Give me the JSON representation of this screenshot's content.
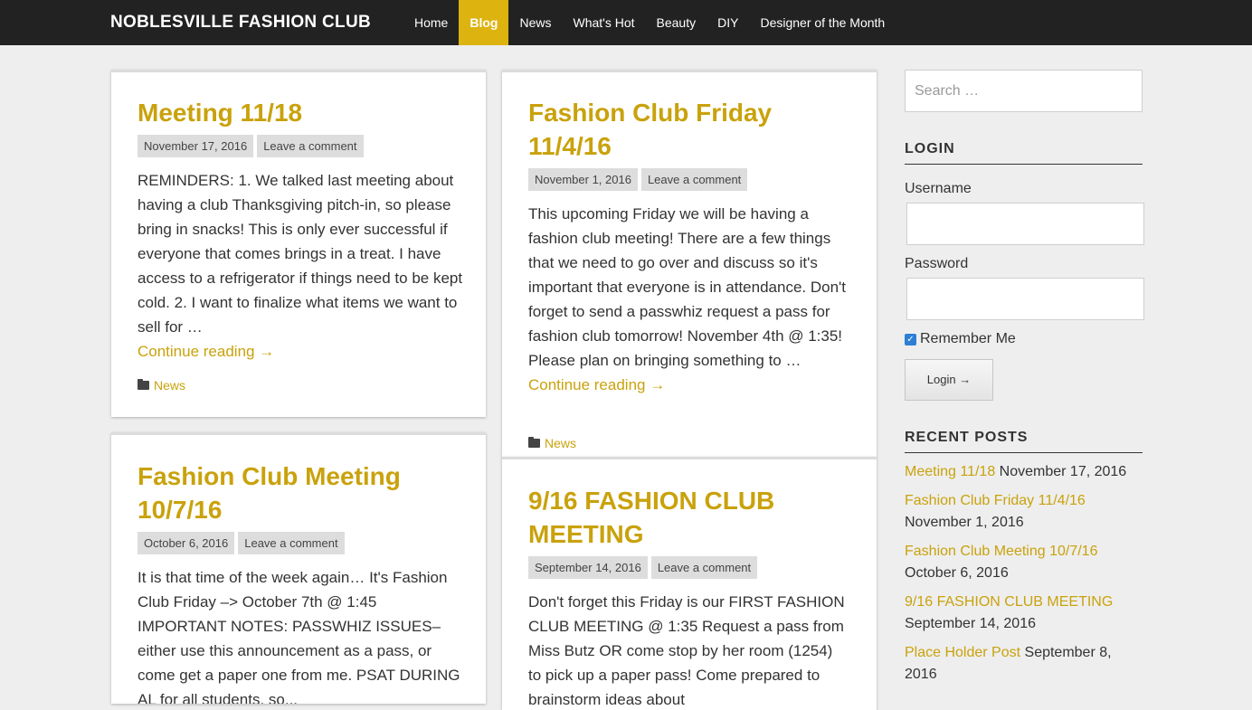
{
  "site": {
    "title": "NOBLESVILLE FASHION CLUB"
  },
  "nav": {
    "items": [
      "Home",
      "Blog",
      "News",
      "What's Hot",
      "Beauty",
      "DIY",
      "Designer of the Month"
    ],
    "active": "Blog"
  },
  "colors": {
    "accent": "#ddb30f",
    "link": "#c9a20c",
    "topbar": "#222222"
  },
  "posts": [
    {
      "title": "Meeting 11/18",
      "date": "November 17, 2016",
      "comment": "Leave a comment",
      "excerpt": "REMINDERS: 1. We talked last meeting about having a club Thanksgiving pitch-in, so please bring in snacks! This is only ever successful if everyone that comes brings in a treat. I have access to a refrigerator if things need to be kept cold. 2. I want to finalize what items we want to sell for …",
      "more": "Continue reading →",
      "category": "News"
    },
    {
      "title": "Fashion Club Friday 11/4/16",
      "date": "November 1, 2016",
      "comment": "Leave a comment",
      "excerpt": "This upcoming Friday we will be having a fashion club meeting! There are a few things that we need to go over and discuss so it's important that everyone is in attendance. Don't forget to send a passwhiz request a pass for fashion club tomorrow! November 4th @ 1:35! Please plan on bringing something to …",
      "more": "Continue reading →",
      "category": "News"
    },
    {
      "title": "Fashion Club Meeting 10/7/16",
      "date": "October 6, 2016",
      "comment": "Leave a comment",
      "excerpt": "It is that time of the week again… It's Fashion Club Friday –> October 7th @ 1:45 IMPORTANT NOTES: PASSWHIZ ISSUES– either use this announcement as a pass, or come get a paper one from me. PSAT DURING AL for all students, so..."
    },
    {
      "title": "9/16 FASHION CLUB MEETING",
      "date": "September 14, 2016",
      "comment": "Leave a comment",
      "excerpt": "Don't forget this Friday is our FIRST FASHION CLUB MEETING @ 1:35 Request a pass from Miss Butz OR come stop by her room (1254) to pick up a paper pass! Come prepared to brainstorm ideas about"
    }
  ],
  "sidebar": {
    "search_placeholder": "Search …",
    "login_title": "LOGIN",
    "username_label": "Username",
    "password_label": "Password",
    "remember_label": "Remember Me",
    "login_button": "Login →",
    "recent_title": "RECENT POSTS",
    "recent": [
      {
        "title": "Meeting 11/18",
        "date": "November 17, 2016"
      },
      {
        "title": "Fashion Club Friday 11/4/16",
        "date": "November 1, 2016"
      },
      {
        "title": "Fashion Club Meeting 10/7/16",
        "date": "October 6, 2016"
      },
      {
        "title": "9/16 FASHION CLUB MEETING",
        "date": "September 14, 2016"
      },
      {
        "title": "Place Holder Post",
        "date": "September 8, 2016"
      }
    ]
  }
}
